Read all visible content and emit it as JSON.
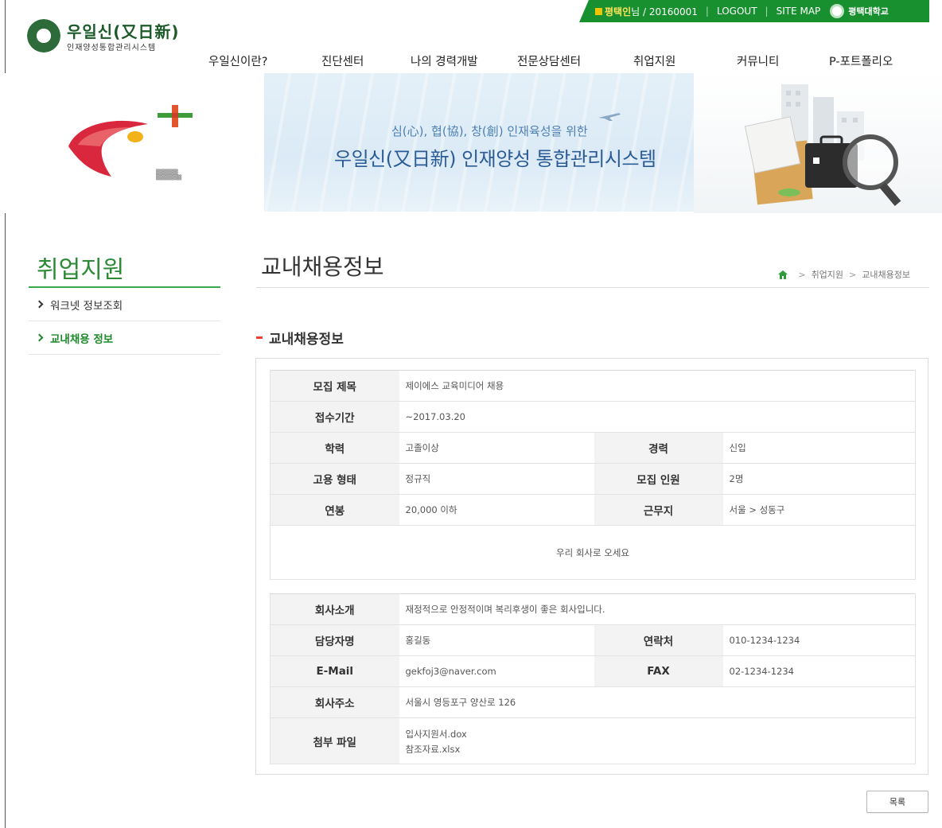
{
  "header": {
    "logo_title": "우일신(又日新)",
    "logo_sub": "인재양성통합관리시스템",
    "user": {
      "name": "평택인",
      "suffix": " 님 / 20160001"
    },
    "logout_label": "LOGOUT",
    "sitemap_label": "SITE MAP",
    "university_name": "평택대학교",
    "colors": {
      "util_bar": "#19902f",
      "brand_green": "#1d5a2a"
    }
  },
  "gnb": {
    "items": [
      "우일신이란?",
      "진단센터",
      "나의 경력개발",
      "전문상담센터",
      "취업지원",
      "커뮤니티",
      "P-포트폴리오"
    ]
  },
  "banner": {
    "sub": "심(心), 협(協), 창(創) 인재육성을 위한",
    "main": "우일신(又日新) 인재양성 통합관리시스템"
  },
  "sidebar": {
    "title": "취업지원",
    "items": [
      {
        "label": "워크넷 정보조회",
        "active": false
      },
      {
        "label": "교내채용 정보",
        "active": true
      }
    ]
  },
  "content": {
    "page_title": "교내채용정보",
    "breadcrumb": [
      "취업지원",
      "교내채용정보"
    ],
    "section_title": "교내채용정보",
    "recruitment": {
      "title_label": "모집 제목",
      "title_value": "제이에스 교육미디어 채용",
      "period_label": "접수기간",
      "period_value": "~2017.03.20",
      "education_label": "학력",
      "education_value": "고졸이상",
      "career_label": "경력",
      "career_value": "신입",
      "employment_label": "고용 형태",
      "employment_value": "정규직",
      "headcount_label": "모집 인원",
      "headcount_value": "2명",
      "salary_label": "연봉",
      "salary_value": "20,000 이하",
      "location_label": "근무지",
      "location_value": "서울 > 성동구",
      "description": "우리 회사로 오세요"
    },
    "company": {
      "intro_label": "회사소개",
      "intro_value": "재정적으로 안정적이며 복리후생이 좋은 회사입니다.",
      "manager_label": "담당자명",
      "manager_value": "홍길동",
      "contact_label": "연락처",
      "contact_value": "010-1234-1234",
      "email_label": "E-Mail",
      "email_value": "gekfoj3@naver.com",
      "fax_label": "FAX",
      "fax_value": "02-1234-1234",
      "address_label": "회사주소",
      "address_value": "서울시 영등포구 양산로 126",
      "files_label": "첨부 파일",
      "files": [
        "입사지원서.dox",
        "참조자료.xlsx"
      ]
    },
    "list_button_label": "목록"
  }
}
